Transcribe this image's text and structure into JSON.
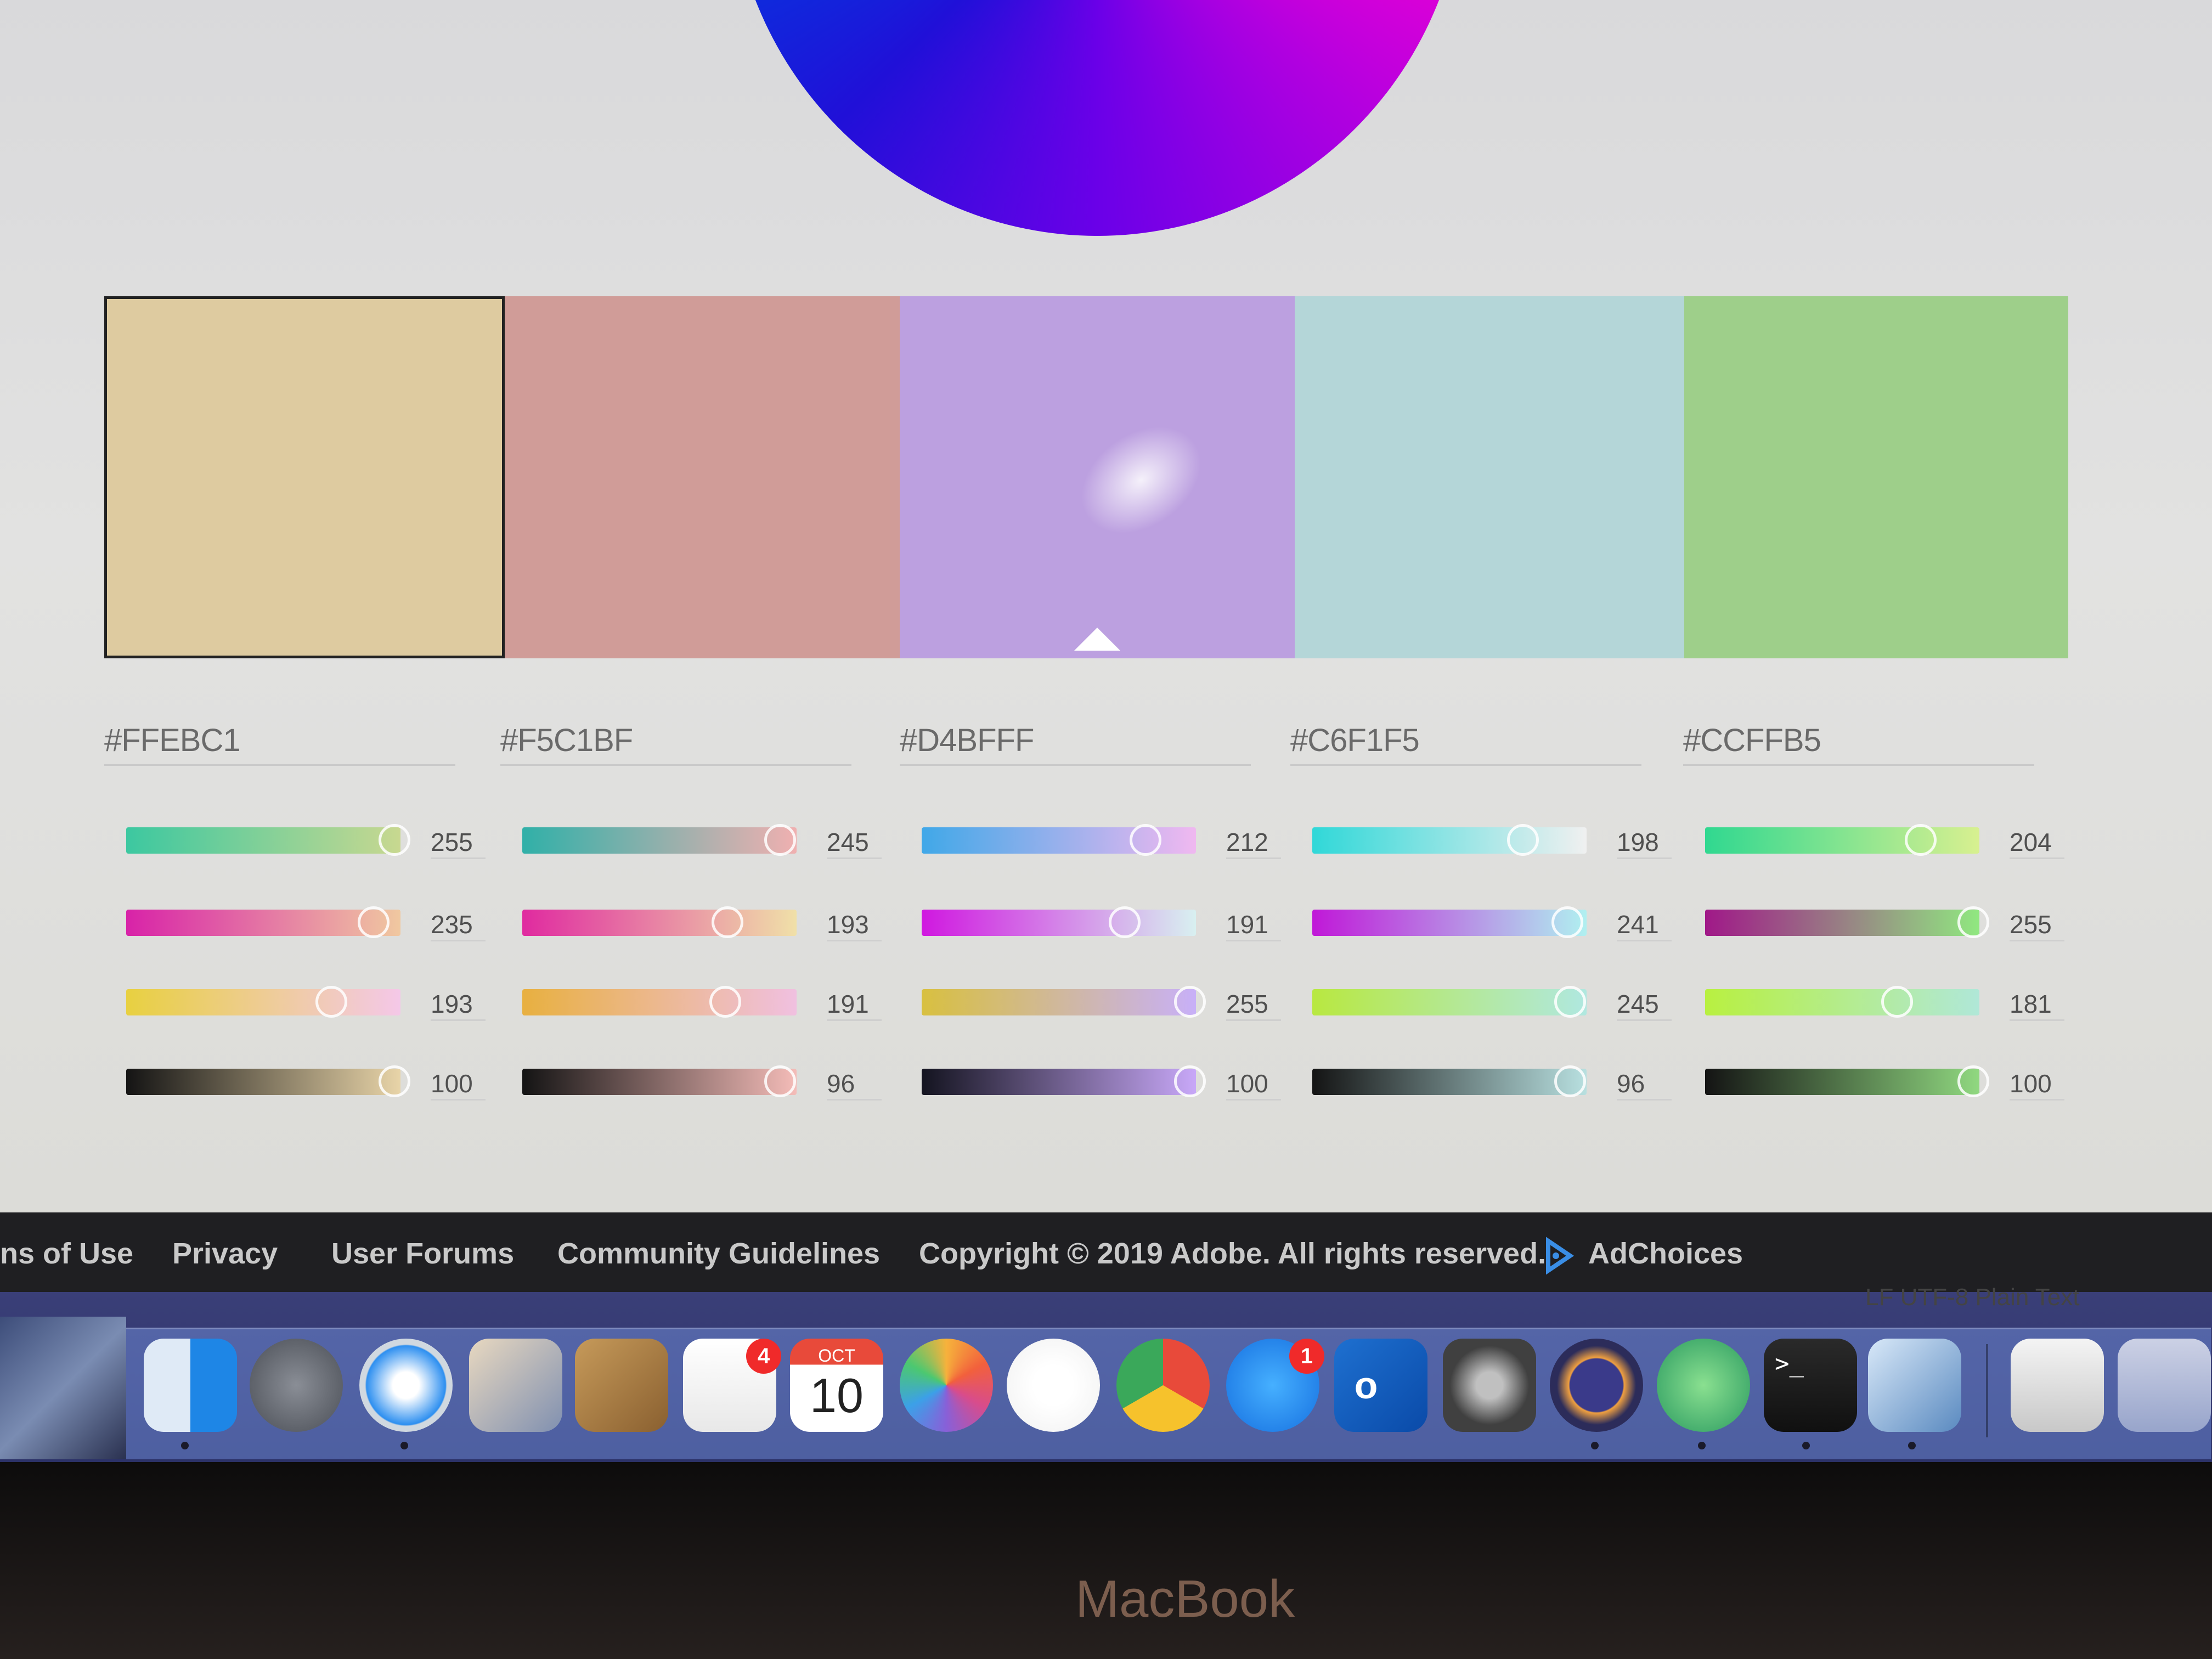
{
  "swatches": [
    {
      "color": "#DECBA0",
      "active": true
    },
    {
      "color": "#D09C98"
    },
    {
      "color": "#BCA0E0",
      "selected_indicator": true
    },
    {
      "color": "#B4D6D8"
    },
    {
      "color": "#9ECF8A"
    }
  ],
  "columns": [
    {
      "hex": "#FFEBC1",
      "rows": [
        {
          "value": "255",
          "fraction": 1.0,
          "gradient": [
            "#3cc8a0",
            "#c8d890"
          ]
        },
        {
          "value": "235",
          "fraction": 0.92,
          "gradient": [
            "#d822a8",
            "#f0c8a0"
          ]
        },
        {
          "value": "193",
          "fraction": 0.76,
          "gradient": [
            "#e8d040",
            "#f4c8e8"
          ]
        },
        {
          "value": "100",
          "fraction": 1.0,
          "gradient": [
            "#141414",
            "#e8d4a8"
          ]
        }
      ]
    },
    {
      "hex": "#F5C1BF",
      "rows": [
        {
          "value": "245",
          "fraction": 0.96,
          "gradient": [
            "#30b0a8",
            "#f0b0b0"
          ]
        },
        {
          "value": "193",
          "fraction": 0.76,
          "gradient": [
            "#e02aa0",
            "#f0e0a8"
          ]
        },
        {
          "value": "191",
          "fraction": 0.75,
          "gradient": [
            "#e8b040",
            "#f0c0e0"
          ]
        },
        {
          "value": "96",
          "fraction": 0.96,
          "gradient": [
            "#141414",
            "#f4bcb8"
          ]
        }
      ]
    },
    {
      "hex": "#D4BFFF",
      "rows": [
        {
          "value": "212",
          "fraction": 0.83,
          "gradient": [
            "#40a8e8",
            "#f0b8f0"
          ]
        },
        {
          "value": "191",
          "fraction": 0.75,
          "gradient": [
            "#d018e0",
            "#d8f0f0"
          ]
        },
        {
          "value": "255",
          "fraction": 1.0,
          "gradient": [
            "#d8c040",
            "#c8b0f8"
          ]
        },
        {
          "value": "100",
          "fraction": 1.0,
          "gradient": [
            "#141420",
            "#c8a8f8"
          ]
        }
      ]
    },
    {
      "hex": "#C6F1F5",
      "rows": [
        {
          "value": "198",
          "fraction": 0.78,
          "gradient": [
            "#30d8d8",
            "#f0f0f0"
          ]
        },
        {
          "value": "241",
          "fraction": 0.95,
          "gradient": [
            "#c018d8",
            "#b0f0f0"
          ]
        },
        {
          "value": "245",
          "fraction": 0.96,
          "gradient": [
            "#b8e840",
            "#b0e8e0"
          ]
        },
        {
          "value": "96",
          "fraction": 0.96,
          "gradient": [
            "#141414",
            "#b8e0e0"
          ]
        }
      ]
    },
    {
      "hex": "#CCFFB5",
      "rows": [
        {
          "value": "204",
          "fraction": 0.8,
          "gradient": [
            "#30d890",
            "#d8f090"
          ]
        },
        {
          "value": "255",
          "fraction": 1.0,
          "gradient": [
            "#a01888",
            "#90e880"
          ]
        },
        {
          "value": "181",
          "fraction": 0.71,
          "gradient": [
            "#b8f040",
            "#b0e8d8"
          ]
        },
        {
          "value": "100",
          "fraction": 1.0,
          "gradient": [
            "#141414",
            "#90d880"
          ]
        }
      ]
    }
  ],
  "footer": {
    "links": [
      "ns of Use",
      "Privacy",
      "User Forums",
      "Community Guidelines"
    ],
    "copyright": "Copyright © 2019 Adobe. All rights reserved.",
    "adchoices": "AdChoices"
  },
  "status_bar": "LF   UTF-8   Plain Text",
  "dock": {
    "apps": [
      "finder-icon",
      "launchpad-icon",
      "safari-icon",
      "mail-icon",
      "contacts-icon",
      "reminders-icon",
      "calendar-icon",
      "photos-icon",
      "music-icon",
      "chrome-icon",
      "app-store-icon",
      "outlook-icon",
      "system-preferences-icon",
      "eclipse-icon",
      "atom-icon",
      "terminal-icon",
      "preview-icon",
      "document-icon",
      "trash-icon"
    ],
    "reminders_badge": "4",
    "app_store_badge": "1",
    "calendar_month": "OCT",
    "calendar_day": "10",
    "outlook_letter": "o"
  },
  "brand": "MacBook",
  "colors": {
    "footer_bg": "#1f1f22",
    "page_bg": "#e0e0df",
    "adchoices_accent": "#3a8ee6"
  }
}
